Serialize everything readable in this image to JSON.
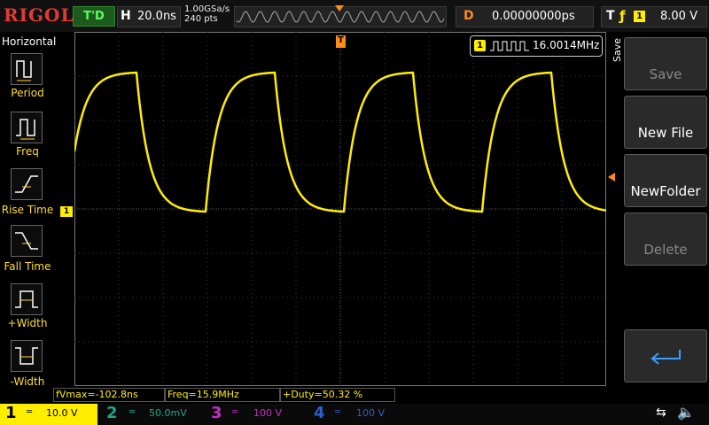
{
  "brand": "RIGOL",
  "trigger_status": "T'D",
  "horizontal": {
    "key": "H",
    "timebase": "20.0ns",
    "sample_rate": "1.00GSa/s",
    "points": "240 pts"
  },
  "delay": {
    "key": "D",
    "value": "0.00000000ps"
  },
  "trigger": {
    "key": "T",
    "edge_symbol": "ƒ",
    "source": "1",
    "level": "8.00 V"
  },
  "left_menu": {
    "title": "Horizontal",
    "items": [
      {
        "label": "Period"
      },
      {
        "label": "Freq"
      },
      {
        "label": "Rise Time"
      },
      {
        "label": "Fall Time"
      },
      {
        "label": "+Width"
      },
      {
        "label": "-Width"
      }
    ]
  },
  "channel_marker": "1",
  "freq_counter": {
    "channel": "1",
    "value": "16.0014MHz"
  },
  "right_menu": {
    "title": "Save",
    "buttons": [
      {
        "label": "Save",
        "enabled": false
      },
      {
        "label": "New File",
        "enabled": true
      },
      {
        "label": "NewFolder",
        "enabled": true
      },
      {
        "label": "Delete",
        "enabled": false
      }
    ]
  },
  "measurements": [
    {
      "text": "fVmax=-102.8ns"
    },
    {
      "text": "Freq=15.9MHz"
    },
    {
      "text": "+Duty=50.32 %"
    }
  ],
  "channels": [
    {
      "num": "1",
      "scale": "10.0 V",
      "color": "#ffee00",
      "active": true
    },
    {
      "num": "2",
      "scale": "50.0mV",
      "color": "#1fa58e",
      "active": false
    },
    {
      "num": "3",
      "scale": "100 V",
      "color": "#c030c0",
      "active": false
    },
    {
      "num": "4",
      "scale": "100 V",
      "color": "#2a5fd0",
      "active": false
    }
  ],
  "colors": {
    "trace": "#ffee00",
    "grid": "#3c3c3c",
    "accent": "#ff8c1a"
  }
}
